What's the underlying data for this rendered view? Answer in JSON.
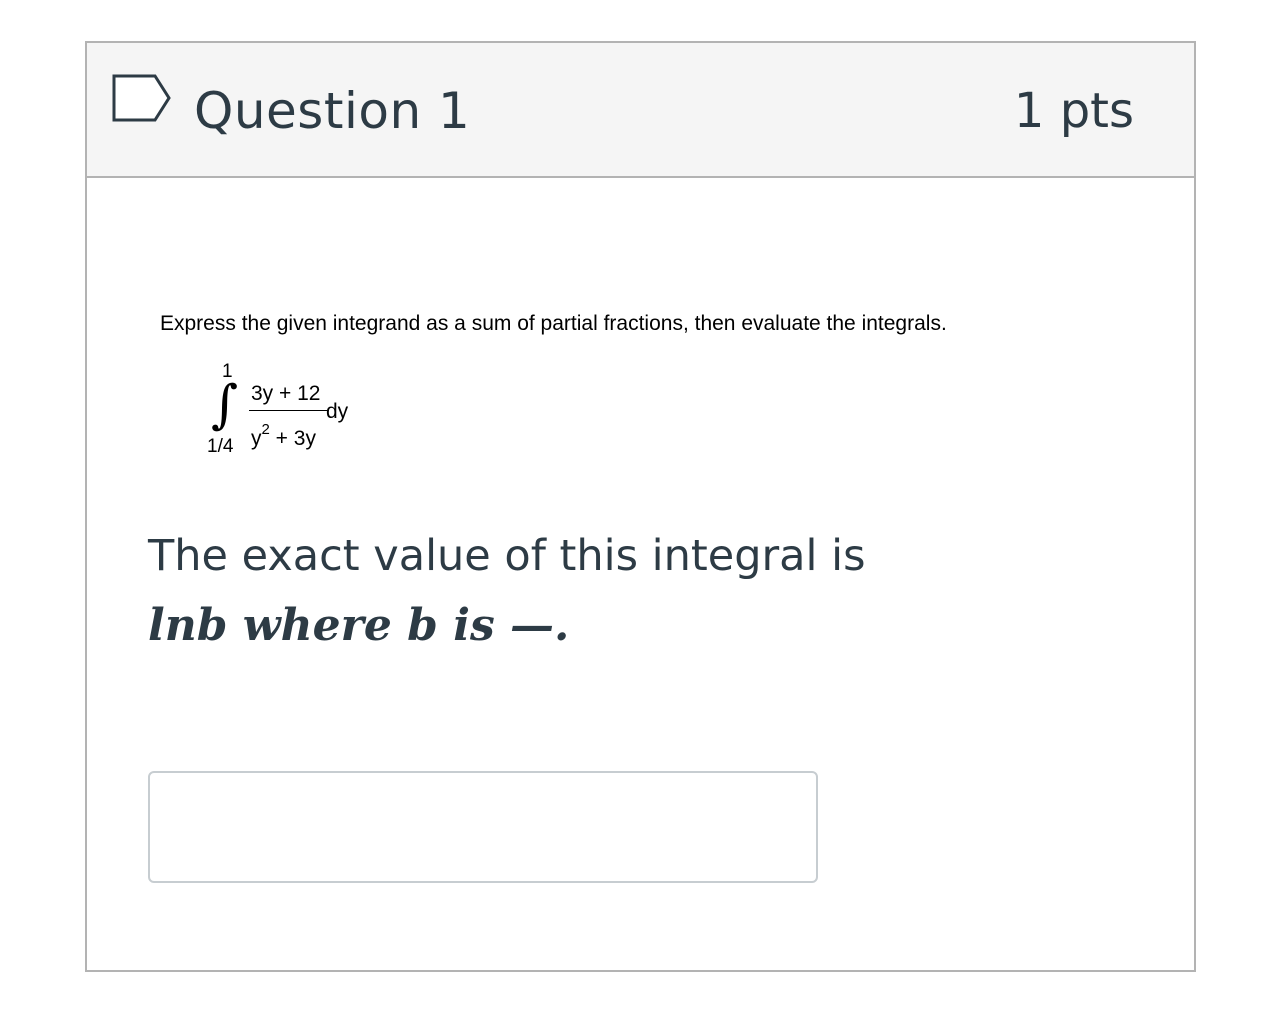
{
  "question": {
    "title": "Question 1",
    "points": "1 pts",
    "flag_icon": "question-flag-icon"
  },
  "problem": {
    "instruction": "Express the given integrand as a sum of partial fractions, then evaluate the integrals.",
    "integral": {
      "upper_limit": "1",
      "lower_limit": "1/4",
      "sign": "∫",
      "numerator": "3y + 12",
      "denominator_base": "y",
      "denominator_exponent": "2",
      "denominator_rest": " + 3y",
      "differential": "dy"
    }
  },
  "prompt": {
    "line1": "The exact value of this integral is",
    "line2": "lnb where b is —."
  },
  "answer": {
    "value": "",
    "placeholder": ""
  },
  "colors": {
    "header_background": "#f5f5f5",
    "border": "#b3b3b3",
    "text_primary": "#2d3b45",
    "flag_outline": "#2d3b45",
    "input_border": "#c7cdd1"
  }
}
